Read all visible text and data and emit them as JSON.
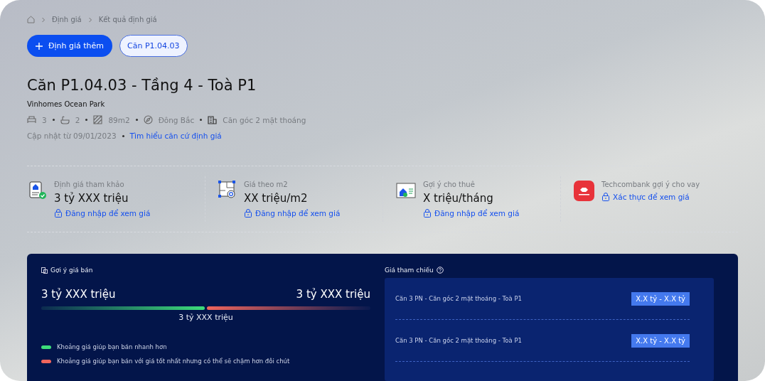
{
  "breadcrumb": [
    "Định giá",
    "Kết quả định giá"
  ],
  "actions": {
    "primary": "Định giá thêm",
    "chip": "Căn P1.04.03"
  },
  "title": "Căn P1.04.03 - Tầng 4 - Toà P1",
  "project": "Vinhomes Ocean Park",
  "features": [
    {
      "kind": "bed",
      "text": "3"
    },
    {
      "kind": "bath",
      "text": "2"
    },
    {
      "kind": "area",
      "text": "89m2"
    },
    {
      "kind": "compass",
      "text": "Đông Bắc"
    },
    {
      "kind": "building",
      "text": "Căn góc 2 mặt thoáng"
    }
  ],
  "updated": {
    "text": "Cập nhật từ 09/01/2023",
    "link": "Tìm hiểu căn cứ định giá"
  },
  "stats": [
    {
      "kind": "valuation",
      "label": "Định giá tham khảo",
      "value": "3 tỷ XXX triệu",
      "link": "Đăng nhập để xem giá"
    },
    {
      "kind": "per_m2",
      "label": "Giá theo m2",
      "value": "XX triệu/m2",
      "link": "Đăng nhập để xem giá"
    },
    {
      "kind": "rent",
      "label": "Gợi ý cho thuê",
      "value": "X triệu/tháng",
      "link": "Đăng nhập để xem giá"
    },
    {
      "kind": "bank",
      "label": "Techcombank gợi ý cho vay",
      "link": "Xác thực để xem giá"
    }
  ],
  "sale": {
    "title": "Gợi ý giá bán",
    "low": "3 tỷ XXX triệu",
    "high": "3 tỷ XXX triệu",
    "mid": "3 tỷ XXX triệu",
    "legend": [
      {
        "color": "#3ddc7a",
        "text": "Khoảng giá giúp bạn bán nhanh hơn"
      },
      {
        "color": "#f0655c",
        "text": "Khoảng giá giúp bạn bán với giá tốt nhất nhưng có thể sẽ chậm hơn đôi chút"
      }
    ]
  },
  "reference": {
    "title": "Giá tham chiếu",
    "rows": [
      {
        "name": "Căn 3 PN - Căn góc 2 mặt thoáng - Toà P1",
        "price": "X.X tỷ - X.X tỷ"
      },
      {
        "name": "Căn 3 PN - Căn góc 2 mặt thoáng - Toà P1",
        "price": "X.X tỷ - X.X tỷ"
      }
    ]
  }
}
